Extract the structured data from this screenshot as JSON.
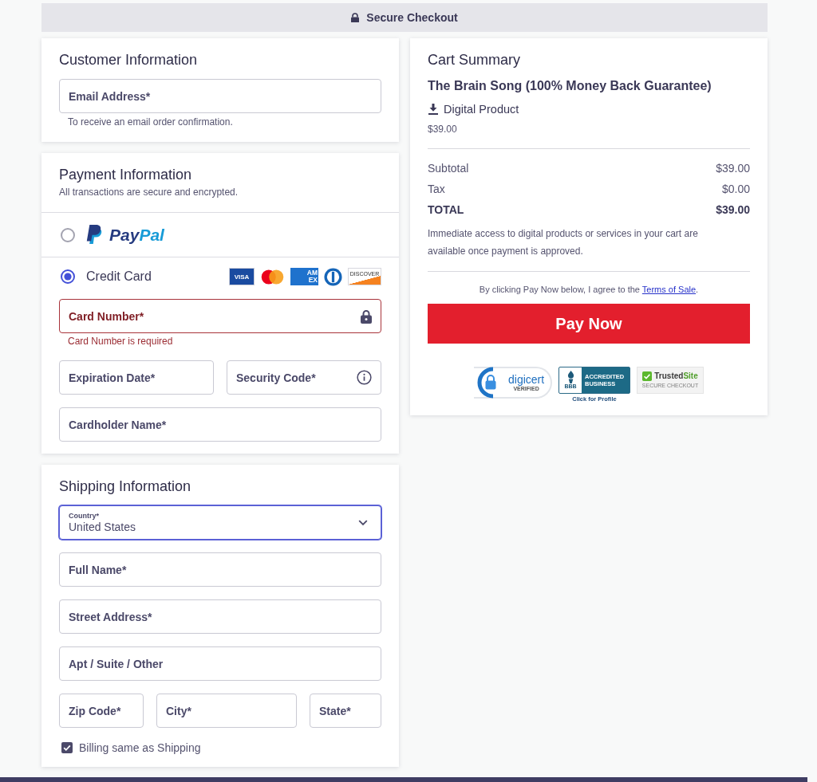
{
  "header": {
    "title": "Secure Checkout"
  },
  "customer": {
    "title": "Customer Information",
    "fields": [
      {
        "kind": "text",
        "label": "Email Address*",
        "error": false,
        "focused": false
      }
    ],
    "hint": "To receive an email order confirmation."
  },
  "payment": {
    "title": "Payment Information",
    "subtitle": "All transactions are secure and encrypted.",
    "methods": [
      {
        "kind": "paypal",
        "selected": false,
        "logo_parts": [
          "Pay",
          "Pal"
        ]
      },
      {
        "kind": "card",
        "selected": true,
        "label": "Credit Card",
        "brands": [
          {
            "kind": "visa",
            "text": "VISA"
          },
          {
            "kind": "mastercard"
          },
          {
            "kind": "amex",
            "text": "AM EX"
          },
          {
            "kind": "diners"
          },
          {
            "kind": "discover",
            "text": "DISCOVER"
          }
        ]
      }
    ],
    "card_rows": [
      [
        {
          "kind": "secure",
          "label": "Card Number*",
          "error": true,
          "focused": false,
          "error_text": "Card Number is required"
        }
      ],
      [
        {
          "kind": "text",
          "label": "Expiration Date*",
          "error": false,
          "focused": false
        },
        {
          "kind": "help",
          "label": "Security Code*",
          "error": false,
          "focused": false
        }
      ],
      [
        {
          "kind": "text",
          "label": "Cardholder Name*",
          "error": false,
          "focused": false
        }
      ]
    ]
  },
  "shipping": {
    "title": "Shipping Information",
    "rows": [
      [
        {
          "kind": "select",
          "label": "Country*",
          "value": "United States",
          "error": false,
          "focused": true
        }
      ],
      [
        {
          "kind": "text",
          "label": "Full Name*",
          "error": false,
          "focused": false
        }
      ],
      [
        {
          "kind": "text",
          "label": "Street Address*",
          "error": false,
          "focused": false
        }
      ],
      [
        {
          "kind": "text",
          "label": "Apt / Suite / Other",
          "error": false,
          "focused": false
        }
      ],
      [
        {
          "kind": "text",
          "label": "Zip Code*",
          "error": false,
          "focused": false
        },
        {
          "kind": "text",
          "label": "City*",
          "error": false,
          "focused": false
        },
        {
          "kind": "text",
          "label": "State*",
          "error": false,
          "focused": false
        }
      ]
    ],
    "billing_same": {
      "label": "Billing same as Shipping",
      "checked": true
    }
  },
  "cart_summary": {
    "title": "Cart Summary",
    "product": {
      "name": "The Brain Song (100% Money Back Guarantee)",
      "type": "Digital Product",
      "price": "$39.00"
    },
    "totals": [
      {
        "kind": "line",
        "label": "Subtotal",
        "amount": "$39.00"
      },
      {
        "kind": "line",
        "label": "Tax",
        "amount": "$0.00"
      },
      {
        "kind": "total",
        "label": "TOTAL",
        "amount": "$39.00"
      }
    ],
    "note": "Immediate access to digital products or services in your cart are available once payment is approved.",
    "agreement": {
      "before": "By clicking Pay Now below, I agree to the ",
      "link": "Terms of Sale",
      "after": "."
    },
    "pay_button": "Pay Now",
    "badges": [
      {
        "kind": "digicert",
        "name": "digicert",
        "caption": "VERIFIED"
      },
      {
        "kind": "bbb",
        "mark": "BBB",
        "name": "ACCREDITED BUSINESS",
        "caption": "Click for Profile"
      },
      {
        "kind": "trustedsite",
        "name_parts": [
          "Trusted",
          "Site"
        ],
        "caption": "SECURE CHECKOUT"
      }
    ]
  }
}
